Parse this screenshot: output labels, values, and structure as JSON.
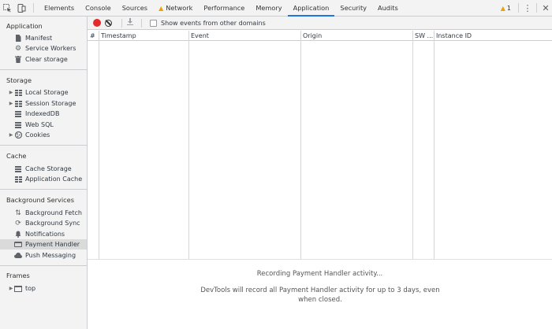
{
  "tabbar": {
    "tabs": [
      "Elements",
      "Console",
      "Sources",
      "Network",
      "Performance",
      "Memory",
      "Application",
      "Security",
      "Audits"
    ],
    "active_tab": "Application",
    "network_warning_icon": "warning-icon",
    "warning_count": "1"
  },
  "sidebar": {
    "application": {
      "title": "Application",
      "items": [
        "Manifest",
        "Service Workers",
        "Clear storage"
      ]
    },
    "storage": {
      "title": "Storage",
      "items": [
        "Local Storage",
        "Session Storage",
        "IndexedDB",
        "Web SQL",
        "Cookies"
      ]
    },
    "cache": {
      "title": "Cache",
      "items": [
        "Cache Storage",
        "Application Cache"
      ]
    },
    "background_services": {
      "title": "Background Services",
      "items": [
        "Background Fetch",
        "Background Sync",
        "Notifications",
        "Payment Handler",
        "Push Messaging"
      ],
      "selected": "Payment Handler"
    },
    "frames": {
      "title": "Frames",
      "items": [
        "top"
      ]
    }
  },
  "toolbar": {
    "checkbox_label": "Show events from other domains",
    "checkbox_checked": false
  },
  "table": {
    "columns": [
      "#",
      "Timestamp",
      "Event",
      "Origin",
      "SW ...",
      "Instance ID"
    ],
    "rows": []
  },
  "empty_state": {
    "title": "Recording Payment Handler activity...",
    "description": "DevTools will record all Payment Handler activity for up to 3 days, even when closed."
  },
  "colors": {
    "accent": "#1a73e8",
    "record": "#e32b2b",
    "warning": "#e8a400"
  }
}
